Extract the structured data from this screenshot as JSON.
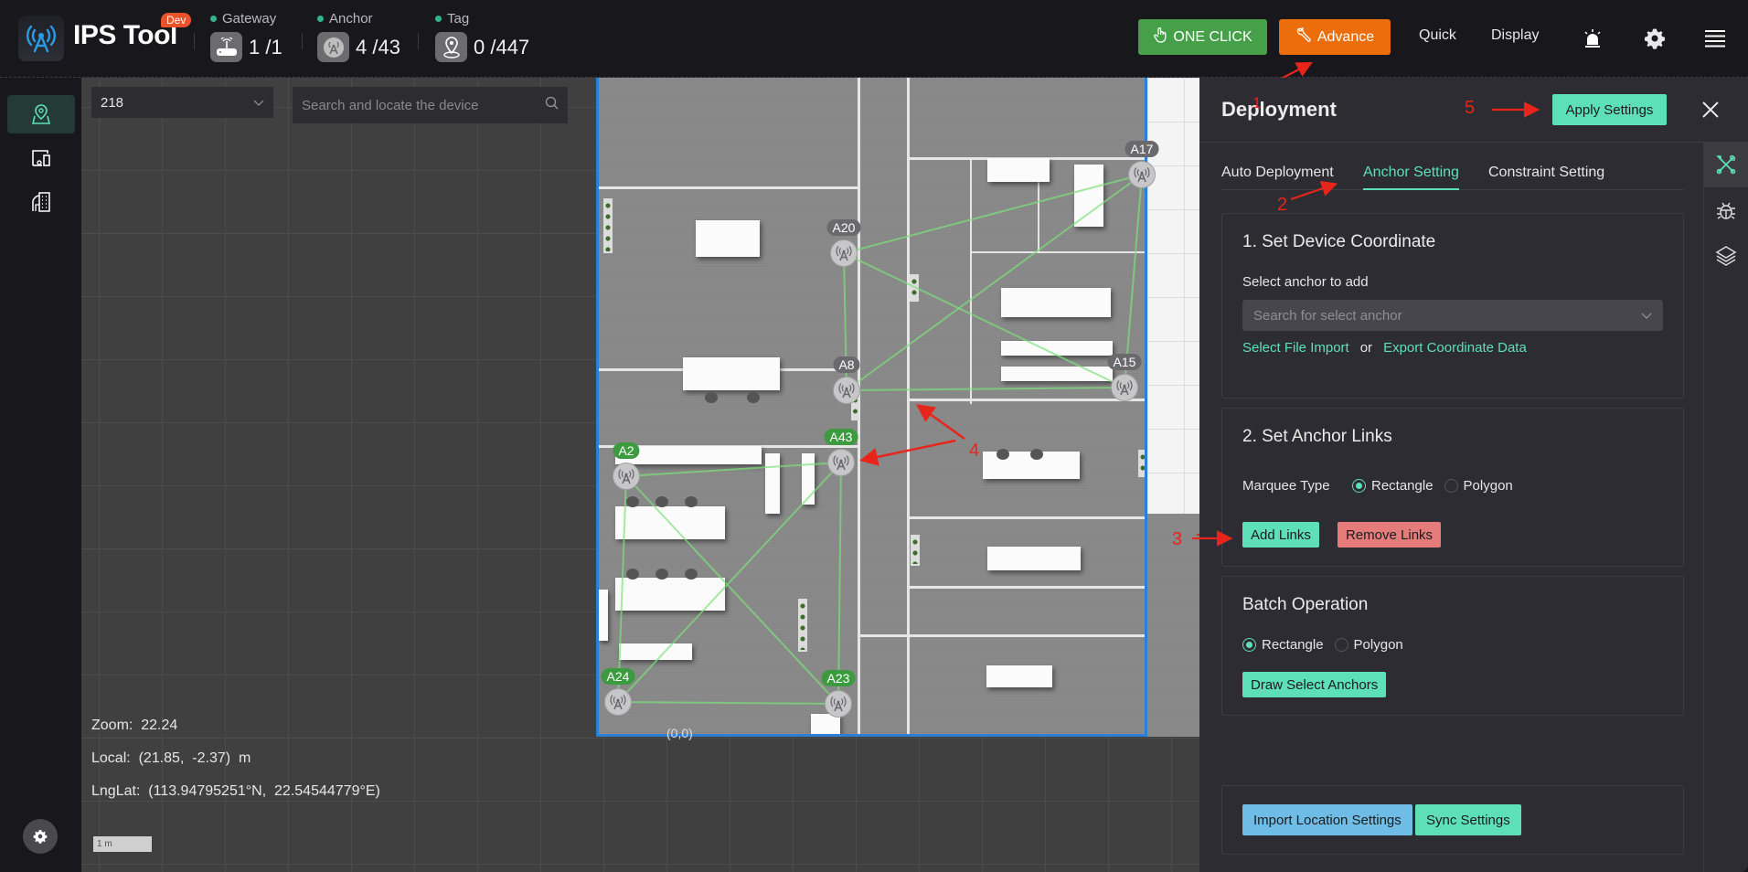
{
  "header": {
    "app_title": "IPS Tool",
    "badge": "Dev",
    "stats": [
      {
        "label": "Gateway",
        "value": "1 /1",
        "icon": "router-icon"
      },
      {
        "label": "Anchor",
        "value": "4 /43",
        "icon": "anchor-tower-icon"
      },
      {
        "label": "Tag",
        "value": "0 /447",
        "icon": "location-pin-icon"
      }
    ],
    "one_click_label": "ONE CLICK",
    "advance_label": "Advance",
    "quick_label": "Quick",
    "display_label": "Display",
    "icons": [
      "alarm-light-icon",
      "gear-icon",
      "menu-icon"
    ]
  },
  "left_nav": {
    "items": [
      {
        "name": "map-location",
        "icon": "map-pin-icon",
        "active": true
      },
      {
        "name": "devices",
        "icon": "devices-icon",
        "active": false
      },
      {
        "name": "buildings",
        "icon": "building-icon",
        "active": false
      }
    ],
    "settings_icon": "gear-icon"
  },
  "map": {
    "floor_select_value": "218",
    "search_placeholder": "Search and locate the device",
    "origin_label": "(0,0)",
    "zoom_text": "Zoom:  22.24",
    "local_text": "Local:  (21.85,  -2.37)  m",
    "lnglat_text": "LngLat:  (113.94795251°N,  22.54544779°E)",
    "scale_label": "1 m",
    "anchors": [
      {
        "id": "A17",
        "selected": false
      },
      {
        "id": "A20",
        "selected": false
      },
      {
        "id": "A8",
        "selected": false
      },
      {
        "id": "A15",
        "selected": false
      },
      {
        "id": "A2",
        "selected": true
      },
      {
        "id": "A43",
        "selected": true
      },
      {
        "id": "A24",
        "selected": true
      },
      {
        "id": "A23",
        "selected": true
      }
    ],
    "links": [
      [
        "A17",
        "A20"
      ],
      [
        "A17",
        "A8"
      ],
      [
        "A17",
        "A15"
      ],
      [
        "A20",
        "A8"
      ],
      [
        "A20",
        "A15"
      ],
      [
        "A8",
        "A15"
      ],
      [
        "A2",
        "A43"
      ],
      [
        "A2",
        "A24"
      ],
      [
        "A2",
        "A23"
      ],
      [
        "A43",
        "A24"
      ],
      [
        "A43",
        "A23"
      ],
      [
        "A24",
        "A23"
      ]
    ],
    "link_color": "#7ee07a"
  },
  "annotations": [
    "1",
    "2",
    "3",
    "4",
    "5"
  ],
  "panel": {
    "title": "Deployment",
    "apply_label": "Apply Settings",
    "tabs": [
      {
        "label": "Auto Deployment",
        "active": false
      },
      {
        "label": "Anchor Setting",
        "active": true
      },
      {
        "label": "Constraint Setting",
        "active": false
      }
    ],
    "section1": {
      "title": "1. Set Device Coordinate",
      "select_label": "Select anchor to add",
      "select_placeholder": "Search for select anchor",
      "import_link": "Select File Import",
      "or_text": "or",
      "export_link": "Export Coordinate Data"
    },
    "section2": {
      "title": "2. Set Anchor Links",
      "marquee_label": "Marquee Type",
      "options": [
        "Rectangle",
        "Polygon"
      ],
      "selected": "Rectangle",
      "add_label": "Add Links",
      "remove_label": "Remove Links"
    },
    "section3": {
      "title": "Batch Operation",
      "options": [
        "Rectangle",
        "Polygon"
      ],
      "selected": "Rectangle",
      "draw_label": "Draw Select Anchors"
    },
    "footer": {
      "import_label": "Import Location Settings",
      "sync_label": "Sync Settings"
    },
    "side_tools": [
      "tools-icon",
      "bug-icon",
      "layers-icon"
    ]
  },
  "colors": {
    "accent": "#5ee0b6",
    "one_click": "#46a049",
    "advance": "#ec6d0b",
    "remove": "#e57b7b",
    "import": "#6fbde6"
  }
}
